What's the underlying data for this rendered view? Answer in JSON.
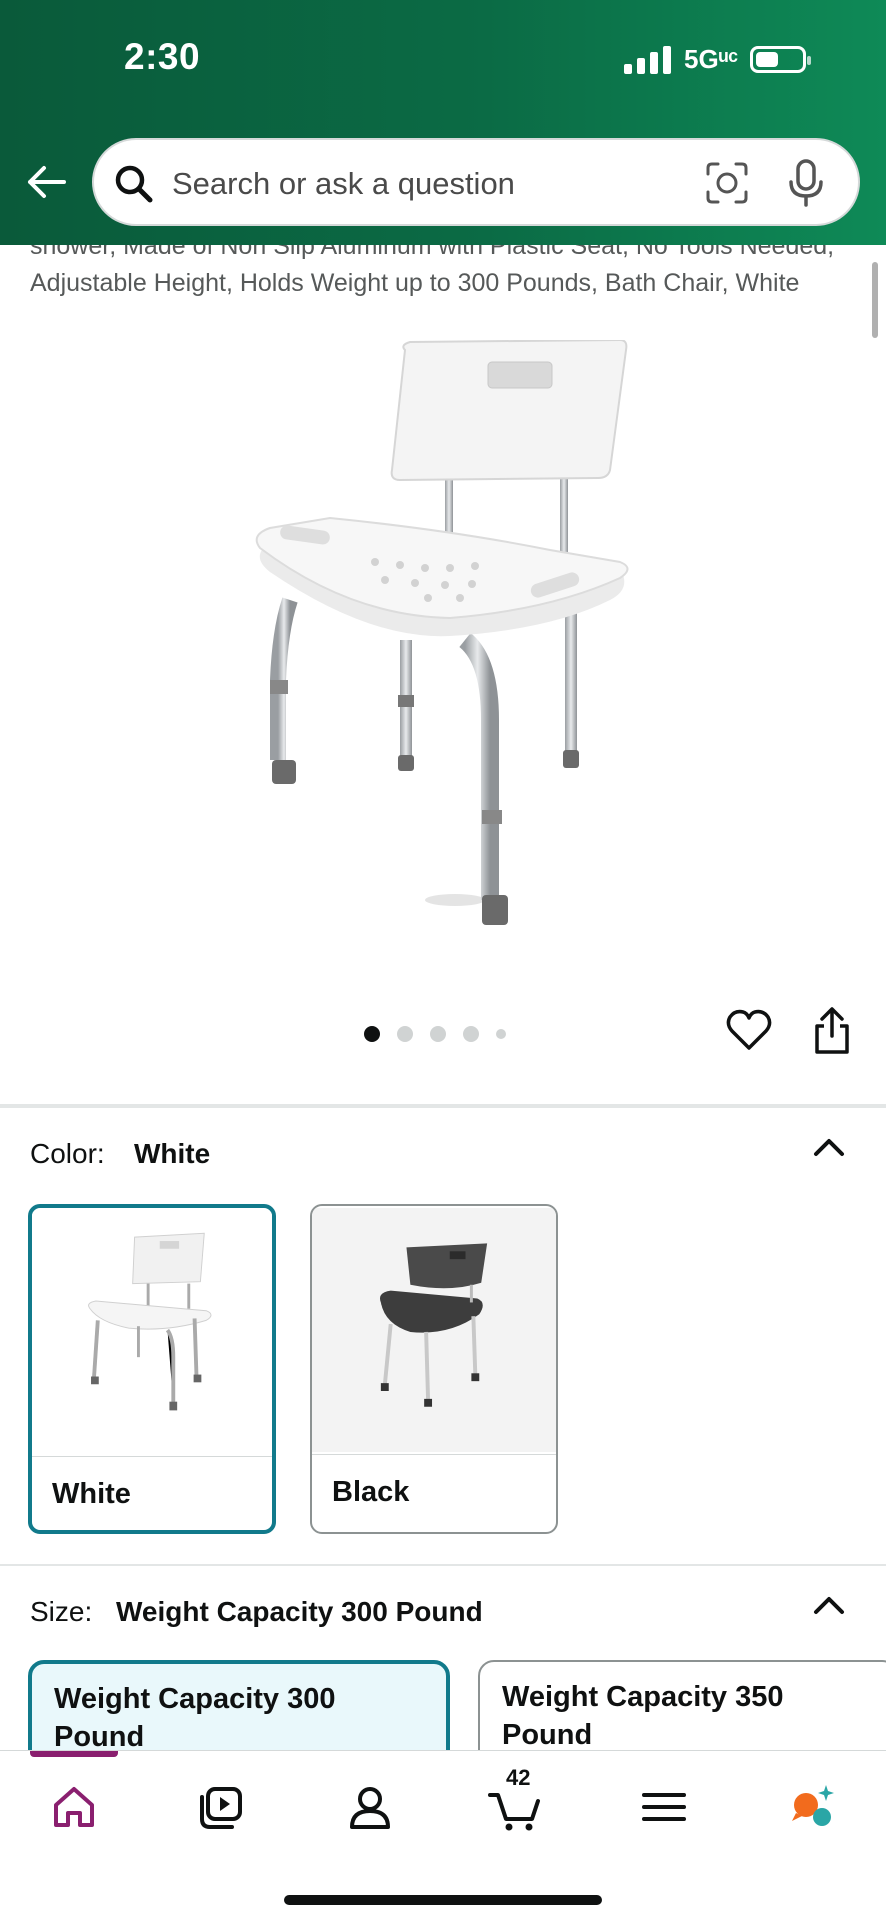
{
  "status_bar": {
    "time": "2:30",
    "network": "5Gᵘᶜ"
  },
  "search": {
    "placeholder": "Search or ask a question"
  },
  "product": {
    "title_partial": "shower, Made of Non Slip Aluminum with Plastic Seat, No Tools Needed, Adjustable Height, Holds Weight up to 300 Pounds, Bath Chair, White",
    "image_count": 5,
    "active_image_index": 0
  },
  "color": {
    "label": "Color:",
    "selected": "White",
    "options": [
      {
        "label": "White",
        "selected": true
      },
      {
        "label": "Black",
        "selected": false
      }
    ]
  },
  "size": {
    "label": "Size:",
    "selected": "Weight Capacity 300 Pound",
    "options": [
      {
        "label": "Weight Capacity 300 Pound",
        "selected": true
      },
      {
        "label": "Weight Capacity 350 Pound",
        "selected": false
      }
    ]
  },
  "bottom_nav": {
    "items": [
      "home-icon",
      "video-icon",
      "account-icon",
      "cart-icon",
      "menu-icon",
      "rufus-icon"
    ],
    "active": "home-icon",
    "cart_count": "42"
  },
  "colors": {
    "header_dark": "#0a5a3a",
    "accent_teal": "#117a8b",
    "nav_active": "#8a1f6f"
  }
}
